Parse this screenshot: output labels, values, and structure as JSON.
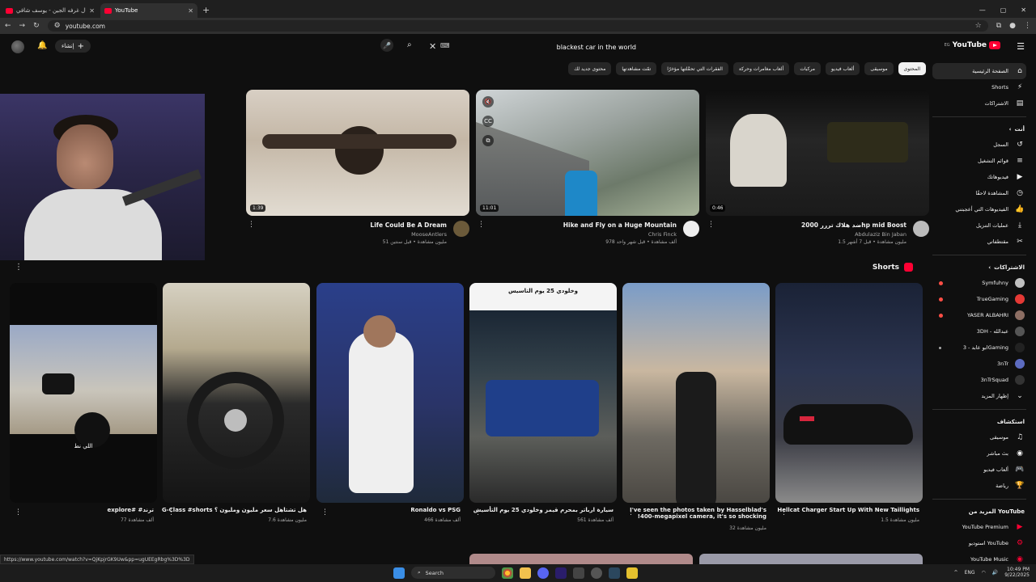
{
  "browser": {
    "tabs": [
      {
        "title": "يا مال غرفه الجين - يوسف شافي",
        "active": false
      },
      {
        "title": "YouTube",
        "active": true
      }
    ],
    "url": "youtube.com"
  },
  "youtube": {
    "logo_word": "YouTube",
    "country_code": "EG",
    "search": {
      "query": "blackest car in the world"
    },
    "create_label": "إنشاء",
    "chips": [
      {
        "label": "المحتوى",
        "active": true
      },
      {
        "label": "موسيقى",
        "active": false
      },
      {
        "label": "ألعاب فيديو",
        "active": false
      },
      {
        "label": "مركبات",
        "active": false
      },
      {
        "label": "ألعاب مغامرات وحركة",
        "active": false
      },
      {
        "label": "الفقرات التي تحمَّلتها مؤخرًا",
        "active": false
      },
      {
        "label": "تمّت مشاهدتها",
        "active": false
      },
      {
        "label": "محتوى جديد لك",
        "active": false
      }
    ],
    "sidebar": {
      "main": [
        {
          "label": "الصفحة الرئيسية",
          "icon": "home-icon",
          "active": true
        },
        {
          "label": "Shorts",
          "icon": "shorts-icon"
        },
        {
          "label": "الاشتراكات",
          "icon": "subscriptions-icon"
        }
      ],
      "you_header": "أنت",
      "you": [
        {
          "label": "السجل",
          "icon": "history-icon"
        },
        {
          "label": "قوائم التشغيل",
          "icon": "playlists-icon"
        },
        {
          "label": "فيديوهاتك",
          "icon": "your-videos-icon"
        },
        {
          "label": "المشاهدة لاحقًا",
          "icon": "watch-later-icon"
        },
        {
          "label": "الفيديوهات التي أعجبتني",
          "icon": "liked-icon"
        },
        {
          "label": "عمليات التنزيل",
          "icon": "download-icon"
        },
        {
          "label": "مقتطفاتي",
          "icon": "clips-icon"
        }
      ],
      "subs_header": "الاشتراكات",
      "subscriptions": [
        {
          "label": "Symfuhny",
          "color": "#c0c0c0",
          "live": true
        },
        {
          "label": "TrueGaming",
          "color": "#e53935",
          "live": true
        },
        {
          "label": "YASER ALBAHRI",
          "color": "#8d6e63",
          "live": true
        },
        {
          "label": "3DH - عبدالله",
          "color": "#555555",
          "live": false
        },
        {
          "label": "ابو عابد - 3Gaming",
          "color": "#222222",
          "live": true
        },
        {
          "label": "3nTr",
          "color": "#5c6bc0",
          "live": false
        },
        {
          "label": "3nTrSquad",
          "color": "#333333",
          "live": false
        }
      ],
      "show_more": "إظهار المزيد",
      "explore_header": "استكشاف",
      "explore": [
        {
          "label": "موسيقى",
          "icon": "music-icon"
        },
        {
          "label": "بث مباشر",
          "icon": "live-icon"
        },
        {
          "label": "ألعاب فيديو",
          "icon": "gaming-icon"
        },
        {
          "label": "رياضة",
          "icon": "trophy-icon"
        }
      ],
      "more_header": "المزيد من YouTube",
      "more": [
        {
          "label": "YouTube Premium",
          "icon": "yt-premium-icon"
        },
        {
          "label": "استوديو YouTube",
          "icon": "yt-studio-icon"
        },
        {
          "label": "YouTube Music",
          "icon": "yt-music-icon"
        }
      ]
    },
    "videos": [
      {
        "title": "Life Could Be A Dream",
        "channel": "MooseAntlers",
        "stats": "51 مليون مشاهدة • قبل سنتين",
        "duration": "1:39",
        "thumb": "chimp"
      },
      {
        "title": "Hike and Fly on a Huge Mountain",
        "channel": "Chris Finck",
        "stats": "978 ألف مشاهدة • قبل شهر واحد",
        "duration": "11:01",
        "thumb": "mountain"
      },
      {
        "title": "ضد هلاك تررر 2000hp mid Boost",
        "channel": "Abdulaziz Bin Jaban",
        "stats": "1.5 مليون مشاهدة • قبل 7 أشهر",
        "duration": "0:46",
        "thumb": "car-night"
      }
    ],
    "shorts_header": "Shorts",
    "shorts": [
      {
        "title": "Hellcat Charger Start Up With New Taillights",
        "views": "1.5 مليون مشاهدة",
        "thumb": "hellcat"
      },
      {
        "title": "I've seen the photos taken by Hasselblad's !400-megapixel camera, it's so shocking",
        "views": "32 مليون مشاهدة",
        "thumb": "camera"
      },
      {
        "title": "سيارة ارباتر بمحرم قيمز وخلودي 25 يوم التأسيس",
        "views": "561 ألف مشاهدة",
        "thumb": "truck",
        "overlay": "وخلودي 25 يوم التاسيس"
      },
      {
        "title": "Ronaldo vs PSG",
        "views": "466 ألف مشاهدة",
        "thumb": "ronaldo"
      },
      {
        "title": "G-Class #shorts هل تشتاهل سعر مليون ومليون ؟",
        "views": "7.6 مليون مشاهدة",
        "thumb": "gclass"
      },
      {
        "title": "explore# #ترند",
        "views": "77 ألف مشاهدة",
        "thumb": "desert",
        "overlay": "اللي نط"
      }
    ],
    "status_link": "https://www.youtube.com/watch?v=QjKpjrGK9Uw&pp=ugUEEgRbg%3D%3D"
  },
  "taskbar": {
    "search_label": "Search",
    "lang": "ENG",
    "time": "10:49 PM",
    "date": "9/22/2025"
  }
}
